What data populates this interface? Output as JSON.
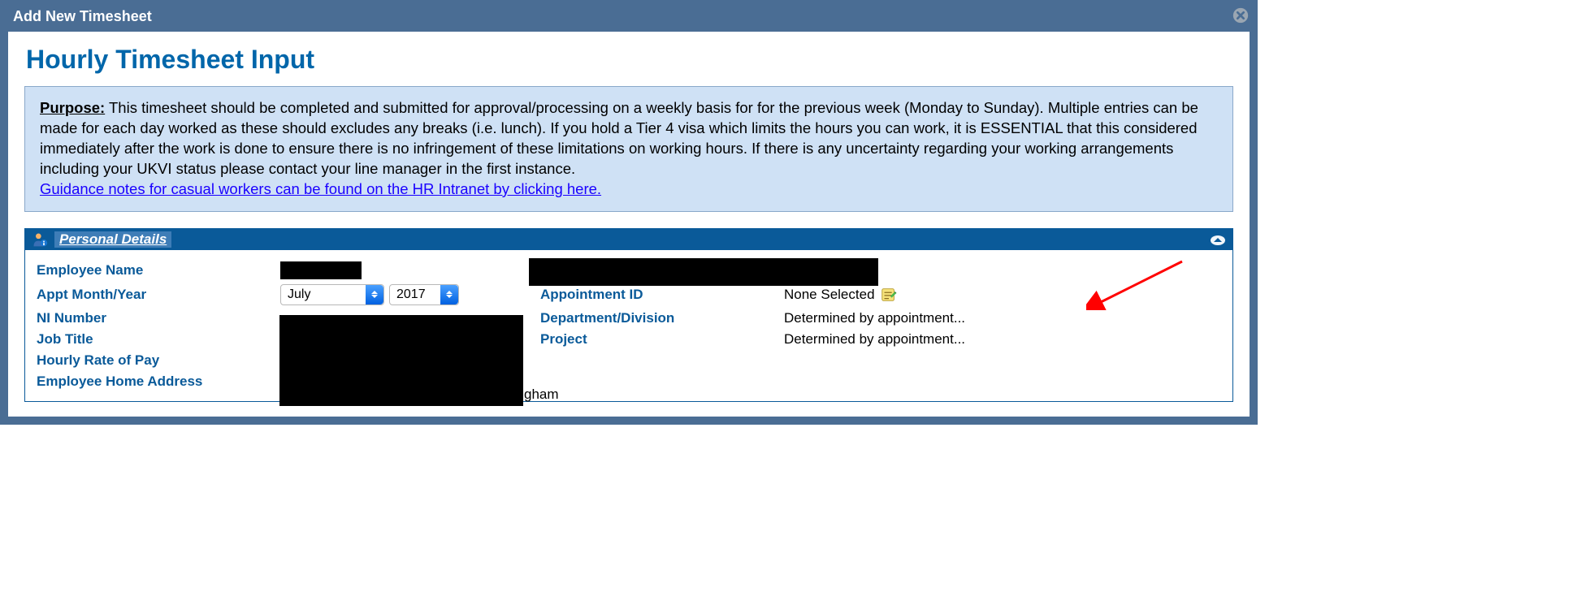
{
  "modal": {
    "title": "Add New Timesheet"
  },
  "page": {
    "heading": "Hourly Timesheet Input"
  },
  "purpose": {
    "label": "Purpose:",
    "text": "This timesheet should be completed and submitted for approval/processing on a weekly basis for for the previous week (Monday to Sunday). Multiple entries can be made for each day worked as these should excludes any breaks (i.e. lunch). If you hold a Tier 4 visa which limits the hours you can work, it is ESSENTIAL that this considered immediately after the work is done to ensure there is no infringement of these limitations on working hours. If there is any uncertainty regarding your working arrangements including your UKVI status please contact your line manager in the first instance.",
    "link": "Guidance notes for casual workers can be found on the HR Intranet by clicking here."
  },
  "panel": {
    "title": "Personal Details"
  },
  "details": {
    "labels": {
      "employee_name": "Employee Name",
      "appt_month_year": "Appt Month/Year",
      "ni_number": "NI Number",
      "job_title": "Job Title",
      "hourly_rate": "Hourly Rate of Pay",
      "home_address": "Employee Home Address",
      "appointment_id": "Appointment ID",
      "department": "Department/Division",
      "project": "Project"
    },
    "values": {
      "month": "July",
      "year": "2017",
      "appointment_id": "None Selected",
      "department": "Determined by appointment...",
      "project": "Determined by appointment...",
      "address_fragment": "gham"
    }
  }
}
